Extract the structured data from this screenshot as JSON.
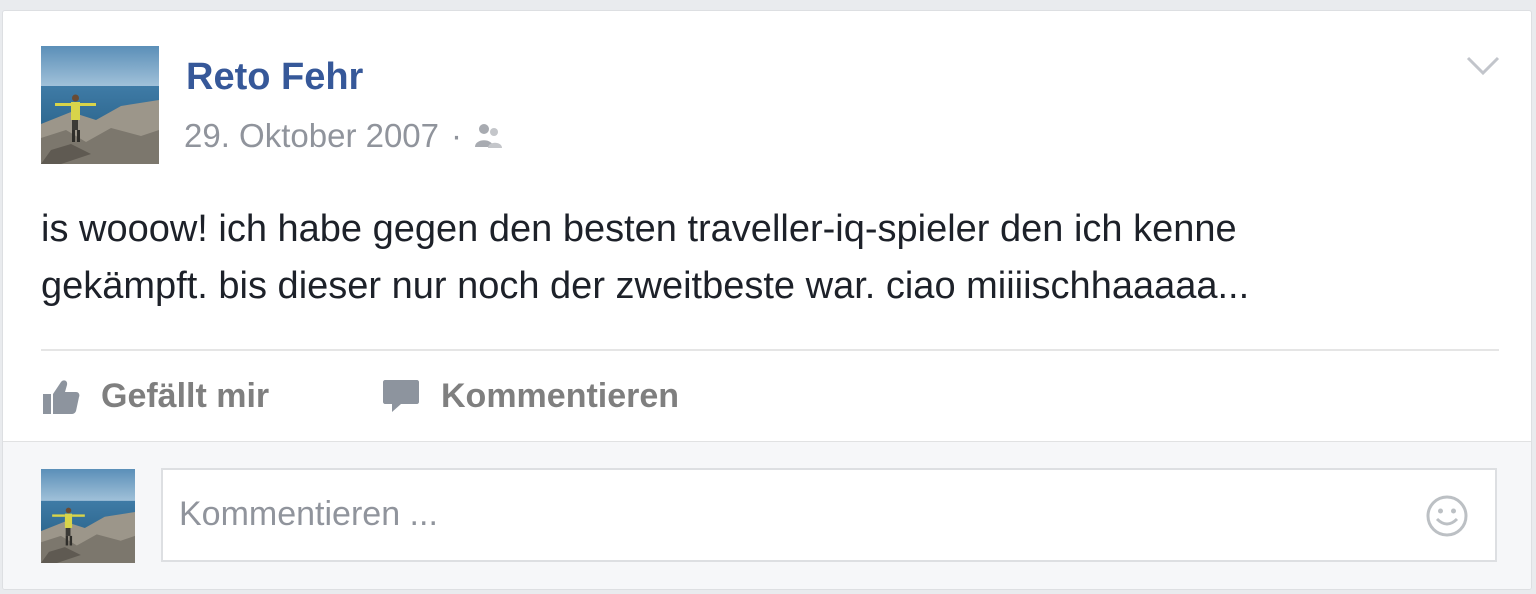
{
  "post": {
    "author_name": "Reto Fehr",
    "date": "29. Oktober 2007",
    "separator": "·",
    "audience_icon": "friends-icon",
    "text_line1": "is wooow! ich habe gegen den besten traveller-iq-spieler den ich kenne",
    "text_line2": "gekämpft. bis dieser nur noch der zweitbeste war. ciao miiiischhaaaaa..."
  },
  "actions": {
    "like_label": "Gefällt mir",
    "comment_label": "Kommentieren"
  },
  "comment_box": {
    "placeholder": "Kommentieren ..."
  },
  "colors": {
    "author_link": "#365899",
    "meta_text": "#90949c",
    "body_text": "#1d2129",
    "action_text": "#7f7f7f"
  }
}
